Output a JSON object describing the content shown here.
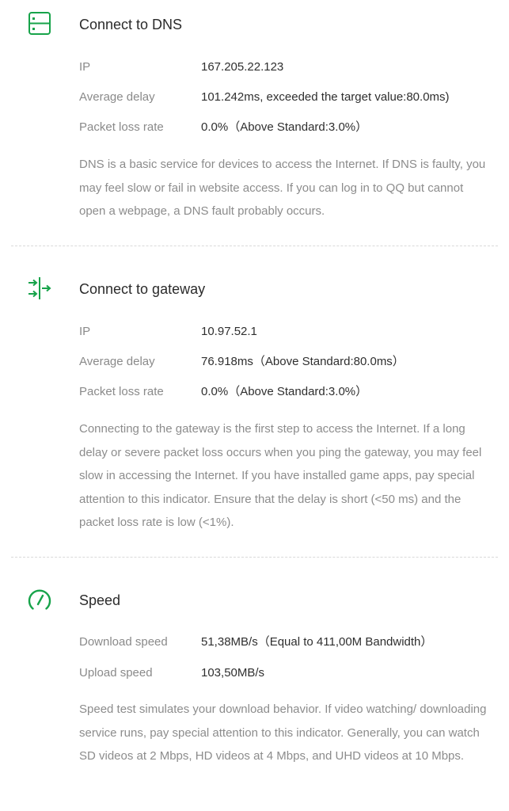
{
  "accent_color": "#17a34a",
  "dns": {
    "icon": "server-icon",
    "title": "Connect to DNS",
    "rows": [
      {
        "label": "IP",
        "value": "167.205.22.123"
      },
      {
        "label": "Average delay",
        "value": "101.242ms, exceeded the target value:80.0ms)"
      },
      {
        "label": "Packet loss rate",
        "value": "0.0%（Above Standard:3.0%）"
      }
    ],
    "description": "DNS is a basic service for devices to access the Internet. If DNS is faulty, you may feel slow or fail in website access. If you can log in to QQ but cannot open a webpage, a DNS fault probably occurs."
  },
  "gateway": {
    "icon": "gateway-arrows-icon",
    "title": "Connect to gateway",
    "rows": [
      {
        "label": "IP",
        "value": "10.97.52.1"
      },
      {
        "label": "Average delay",
        "value": "76.918ms（Above Standard:80.0ms）"
      },
      {
        "label": "Packet loss rate",
        "value": "0.0%（Above Standard:3.0%）"
      }
    ],
    "description": "Connecting to the gateway is the first step to access the Internet. If a long delay or severe packet loss occurs when you ping the gateway, you may feel slow in accessing the Internet. If you have installed game apps, pay special attention to this indicator. Ensure that the delay is short (<50 ms) and the packet loss rate is low (<1%)."
  },
  "speed": {
    "icon": "speedometer-icon",
    "title": "Speed",
    "rows": [
      {
        "label": "Download speed",
        "value": "51,38MB/s（Equal to 411,00M Bandwidth）"
      },
      {
        "label": "Upload speed",
        "value": "103,50MB/s"
      }
    ],
    "description": "Speed test simulates your download behavior. If video watching/ downloading service runs, pay special attention to this indicator. Generally, you can watch SD videos at 2 Mbps, HD videos at 4 Mbps, and UHD videos at 10 Mbps."
  }
}
